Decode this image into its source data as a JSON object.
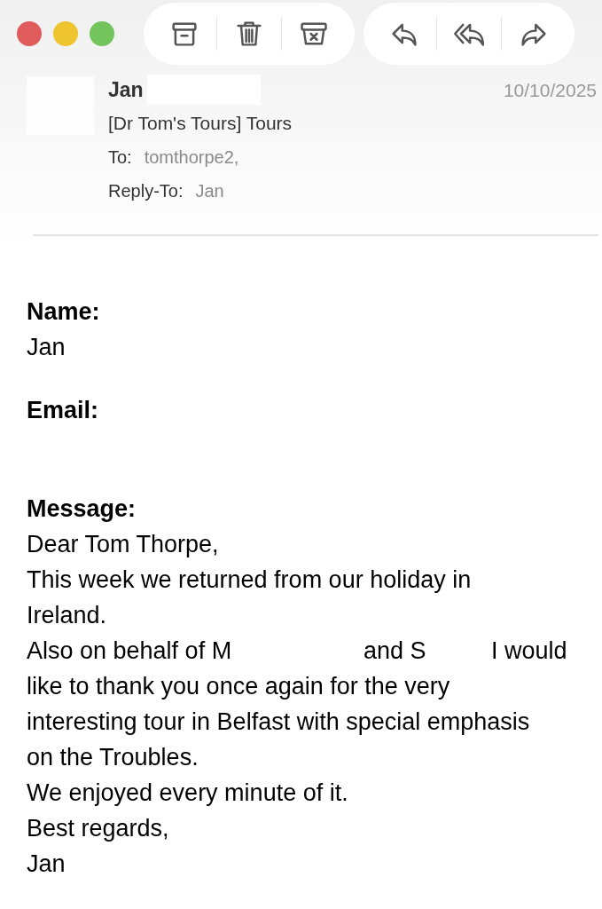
{
  "toolbar": {
    "groups": [
      {
        "buttons": [
          {
            "kind": "archive"
          },
          {
            "kind": "trash"
          },
          {
            "kind": "junk"
          }
        ]
      },
      {
        "buttons": [
          {
            "kind": "reply"
          },
          {
            "kind": "replyall"
          },
          {
            "kind": "forward"
          }
        ]
      }
    ]
  },
  "header": {
    "sender": "Jan",
    "date": "10/10/2025",
    "subject": "[Dr Tom's Tours] Tours",
    "to_label": "To:",
    "to": "tomthorpe2,",
    "reply_to_label": "Reply-To:",
    "reply_to": "Jan"
  },
  "body": {
    "fields": [
      {
        "label": "Name:",
        "value": "Jan"
      },
      {
        "label": "Email:"
      }
    ],
    "message_label": "Message:",
    "message_lines": [
      {
        "kind": "text",
        "text": "Dear Tom Thorpe,"
      },
      {
        "kind": "text",
        "text": "This week we returned from our holiday in Ireland."
      },
      {
        "kind": "redacted",
        "parts": [
          "Also on behalf of M",
          "and S",
          "I would"
        ]
      },
      {
        "kind": "text",
        "text": "like to thank you once again for the very interesting tour in Belfast with special emphasis on the Troubles."
      },
      {
        "kind": "text",
        "text": "We enjoyed every minute of it."
      },
      {
        "kind": "text",
        "text": "Best regards,"
      },
      {
        "kind": "text",
        "text": "Jan"
      }
    ]
  }
}
